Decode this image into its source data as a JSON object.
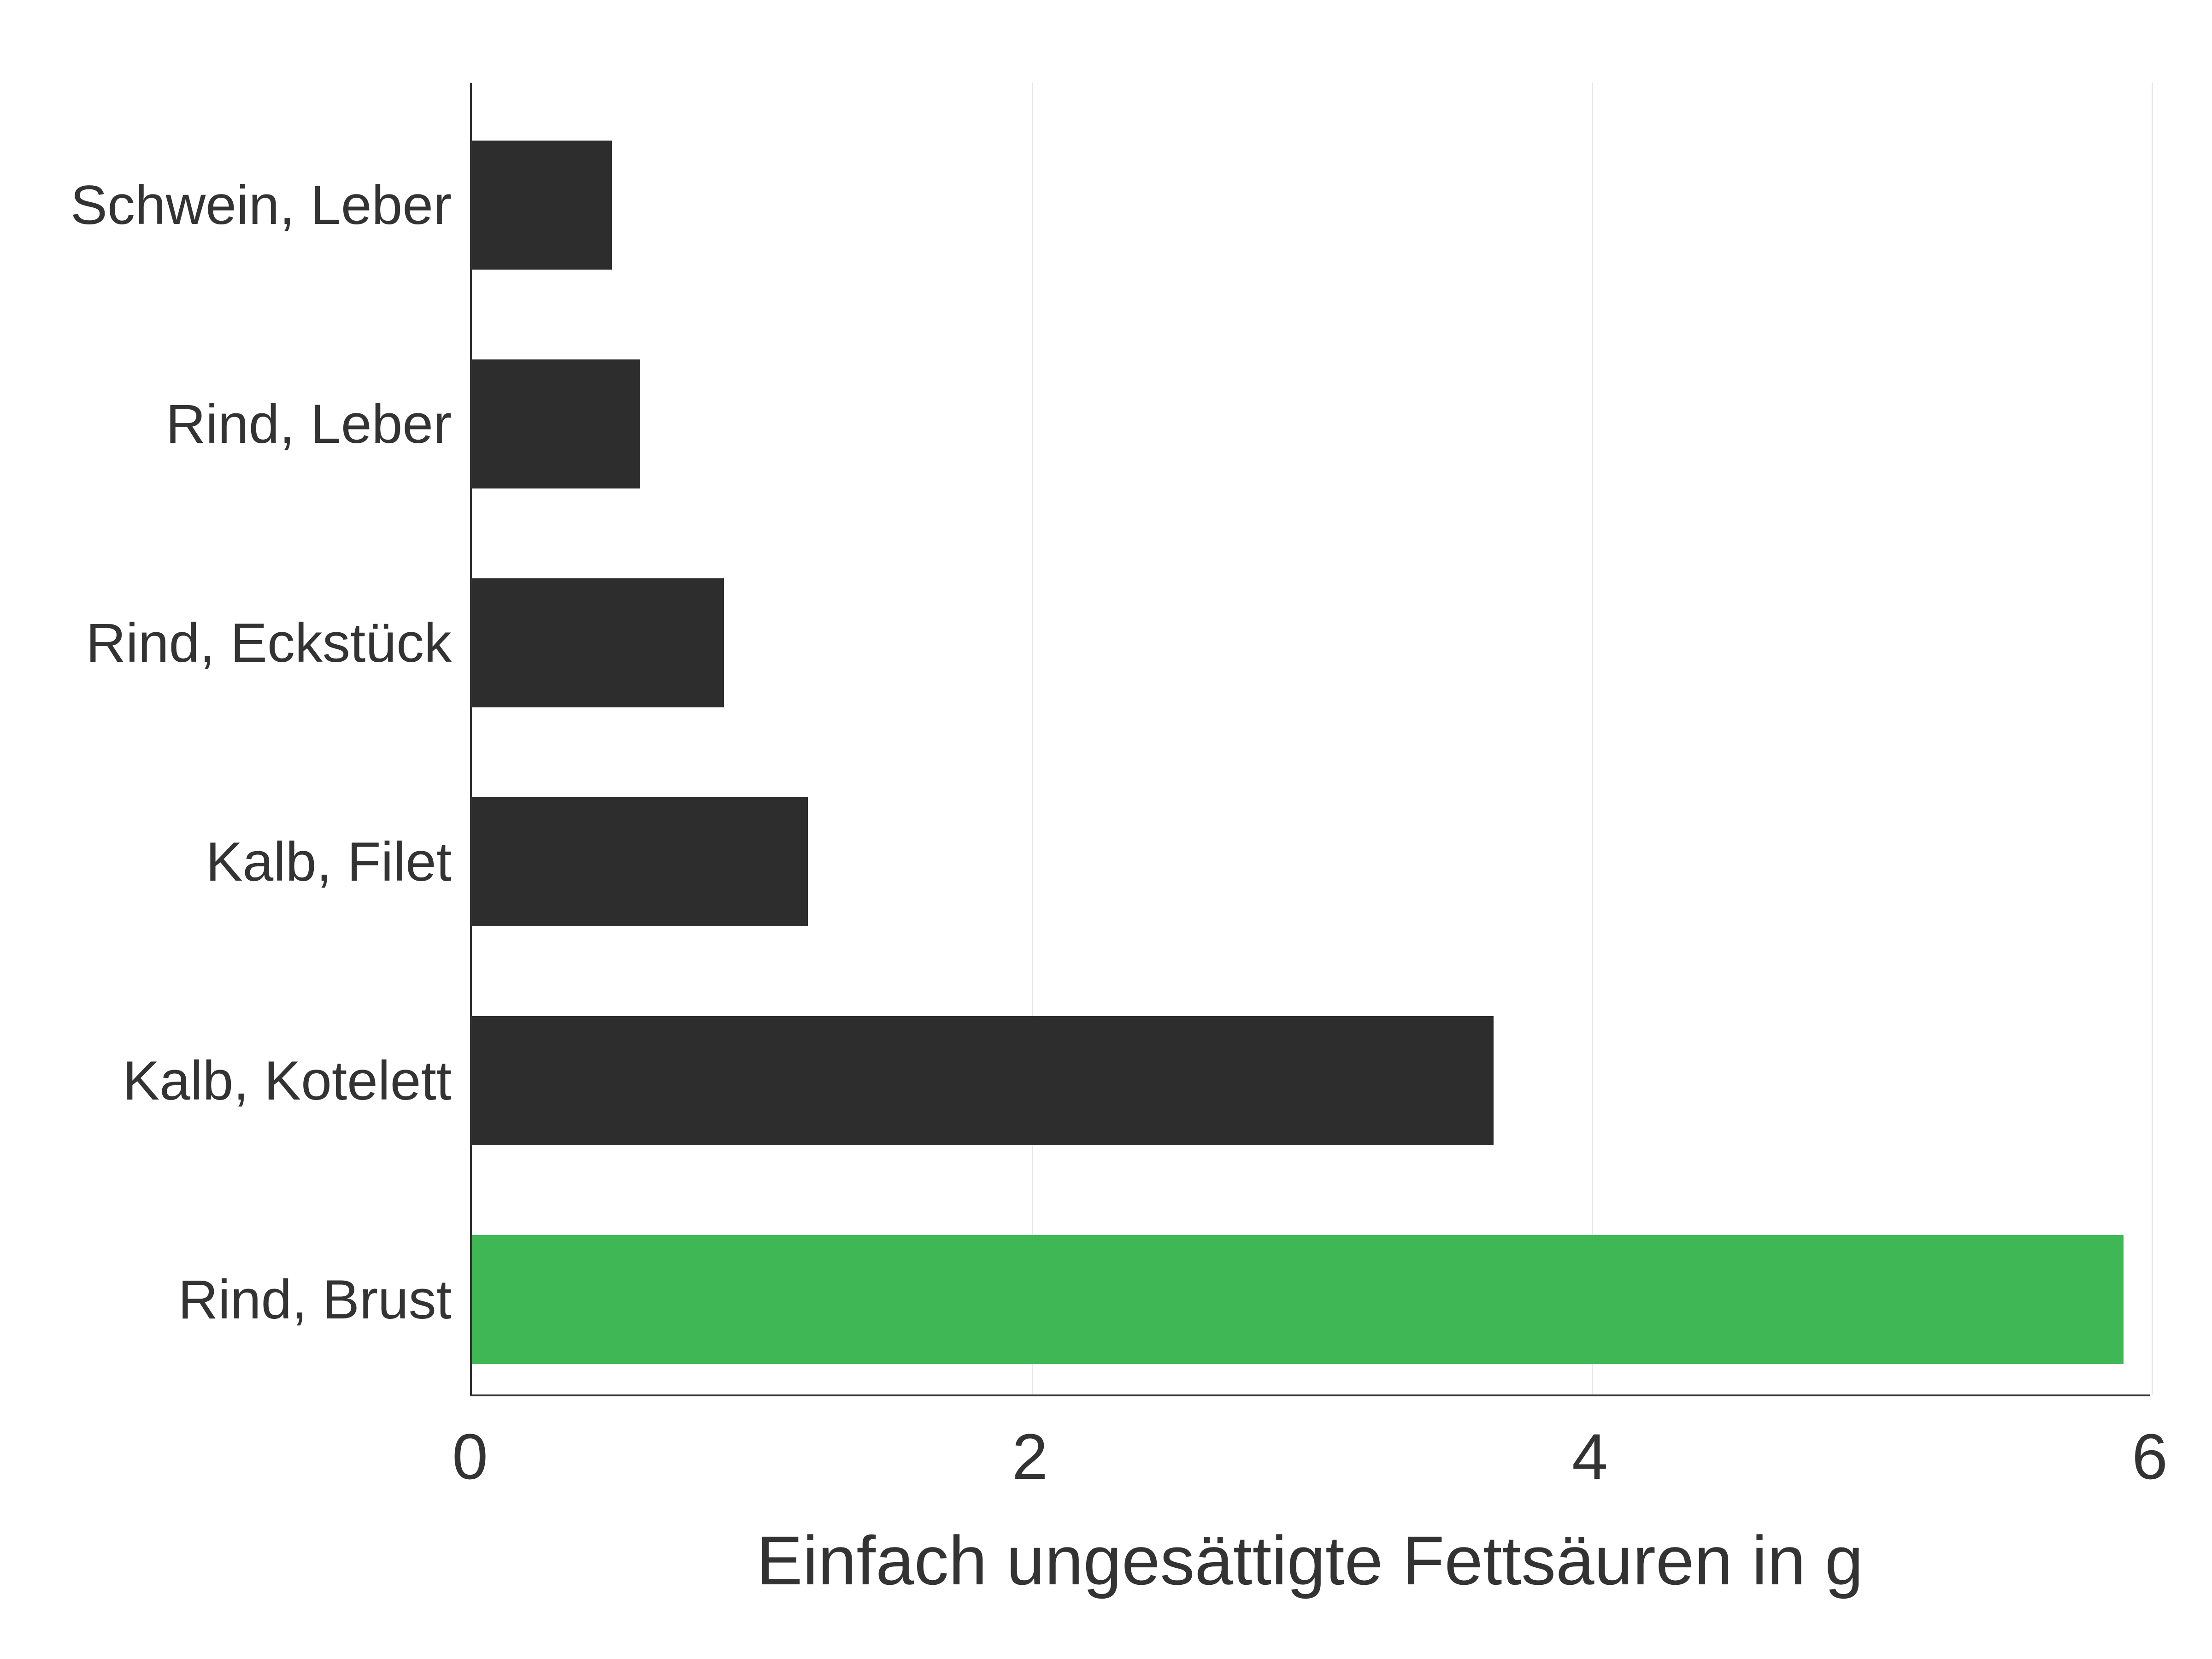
{
  "chart_data": {
    "type": "bar",
    "orientation": "horizontal",
    "categories": [
      "Schwein, Leber",
      "Rind, Leber",
      "Rind, Eckstück",
      "Kalb, Filet",
      "Kalb, Kotelett",
      "Rind, Brust"
    ],
    "values": [
      0.5,
      0.6,
      0.9,
      1.2,
      3.65,
      5.9
    ],
    "highlight_index": 5,
    "xlabel": "Einfach ungesättigte Fettsäuren in g",
    "ylabel": "",
    "xlim": [
      0,
      6
    ],
    "x_ticks": [
      0,
      2,
      4,
      6
    ],
    "title": ""
  },
  "colors": {
    "bar_default": "#2d2d2d",
    "bar_highlight": "#40b755",
    "grid": "#e5e5e5",
    "axis": "#333333"
  }
}
